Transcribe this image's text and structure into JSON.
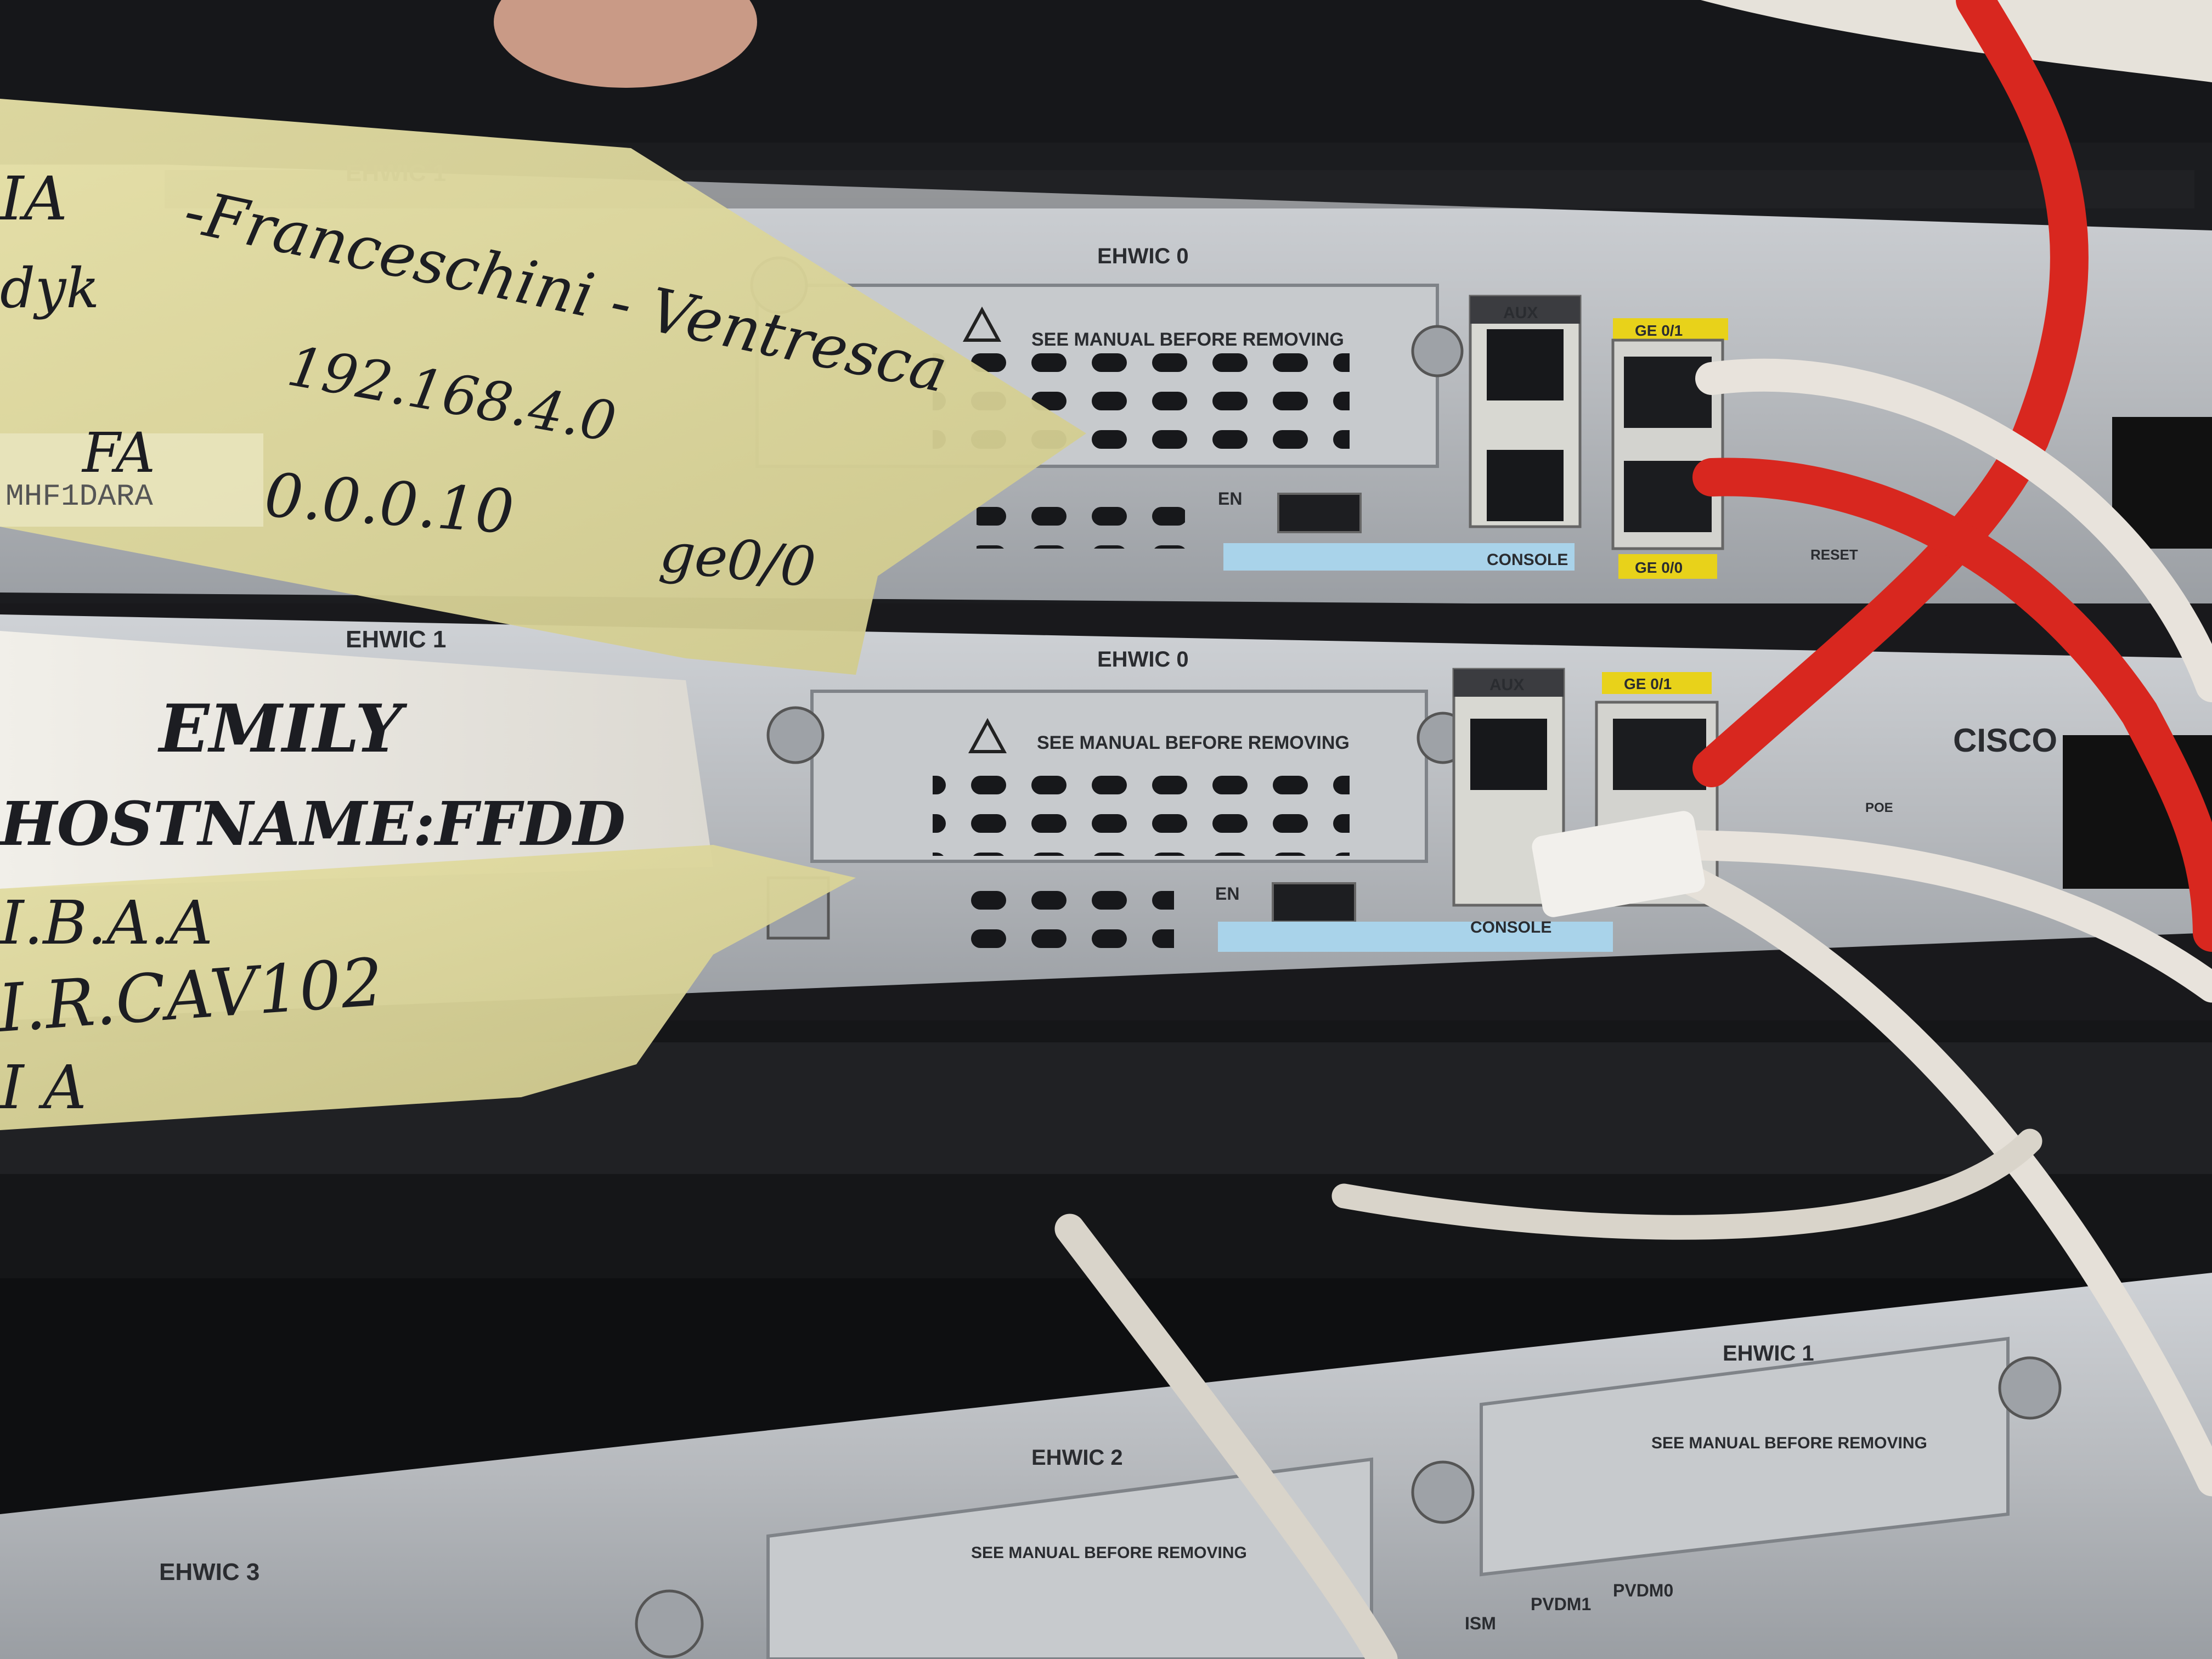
{
  "photo": {
    "description_free": true,
    "panel_labels": {
      "ehwic0": "EHWIC 0",
      "ehwic1": "EHWIC 1",
      "ehwic2": "EHWIC 2",
      "ehwic3": "EHWIC 3",
      "see_manual": "SEE MANUAL BEFORE REMOVING",
      "aux": "AUX",
      "console": "CONSOLE",
      "en": "EN",
      "ge01": "GE 0/1",
      "ge00": "GE 0/0",
      "reset": "RESET",
      "cisco": "CISCO",
      "poe": "POE",
      "ism": "ISM",
      "pvdm1": "PVDM1",
      "pvdm0": "PVDM0",
      "serial": "MHF1DARA"
    },
    "tape_top": {
      "line1": "-Franceschini - Ventresca",
      "line2": "192.168.4.0",
      "line3": "FA",
      "line4": "0.0.0.10",
      "line5": "ge0/0",
      "fragment1": "IA",
      "fragment2": "dyk"
    },
    "tape_middle": {
      "line1": "EMILY",
      "line2": "HOSTNAME:FFDD",
      "line3": "I.B.A.A",
      "line4": "I.R.CAV102",
      "line5": "I A"
    },
    "colors": {
      "chassis": "#b9bcc0",
      "chassis_dark": "#8c9095",
      "tape": "#d9d49a",
      "cable_red": "#d8271f",
      "cable_white": "#e8e3dc",
      "rack": "#131416",
      "port_label_yellow": "#e8d21a",
      "console_blue": "#a9d3ea"
    }
  }
}
